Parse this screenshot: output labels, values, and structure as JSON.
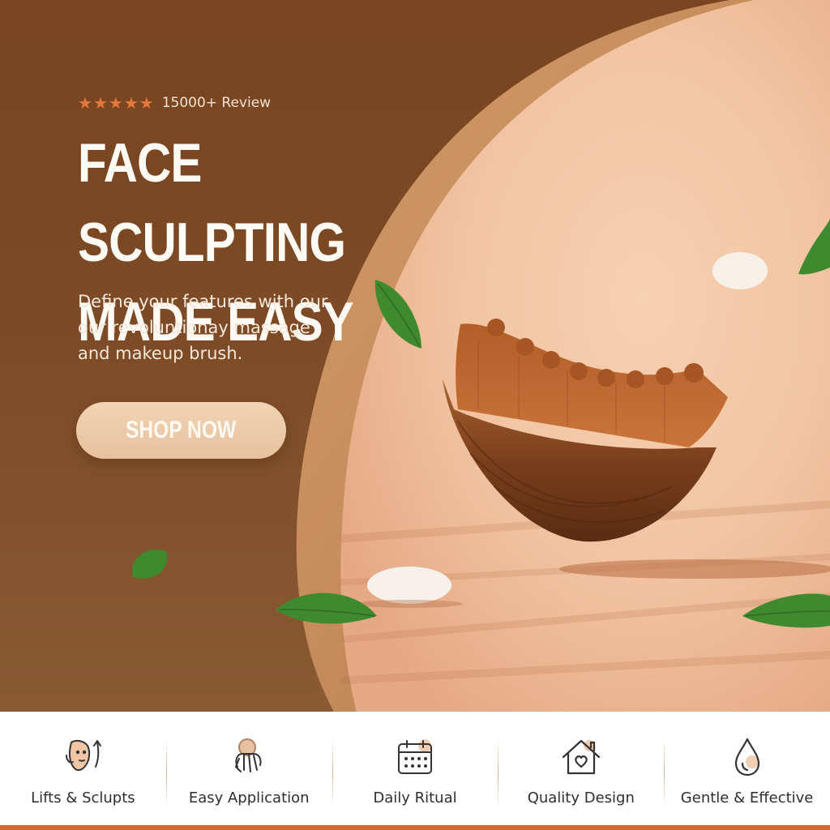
{
  "hero": {
    "rating_stars": 5,
    "rating_text": "15000+ Review",
    "headline": "FACE SCULPTING MADE EASY",
    "description": "Define your features with our our revoluntionay massage and makeup brush.",
    "cta_label": "SHOP NOW"
  },
  "features": [
    {
      "label": "Lifts & Sclupts",
      "icon": "face-lift-icon"
    },
    {
      "label": "Easy Application",
      "icon": "hand-application-icon"
    },
    {
      "label": "Daily Ritual",
      "icon": "calendar-icon"
    },
    {
      "label": "Quality Design",
      "icon": "home-heart-icon"
    },
    {
      "label": "Gentle & Effective",
      "icon": "water-drop-icon"
    }
  ],
  "colors": {
    "brown_panel": "#7a4420",
    "peach_background": "#f3c9a8",
    "star_color": "#e7773d",
    "accent_bar": "#d06a2c",
    "button_fill": "#ecc9a6"
  }
}
